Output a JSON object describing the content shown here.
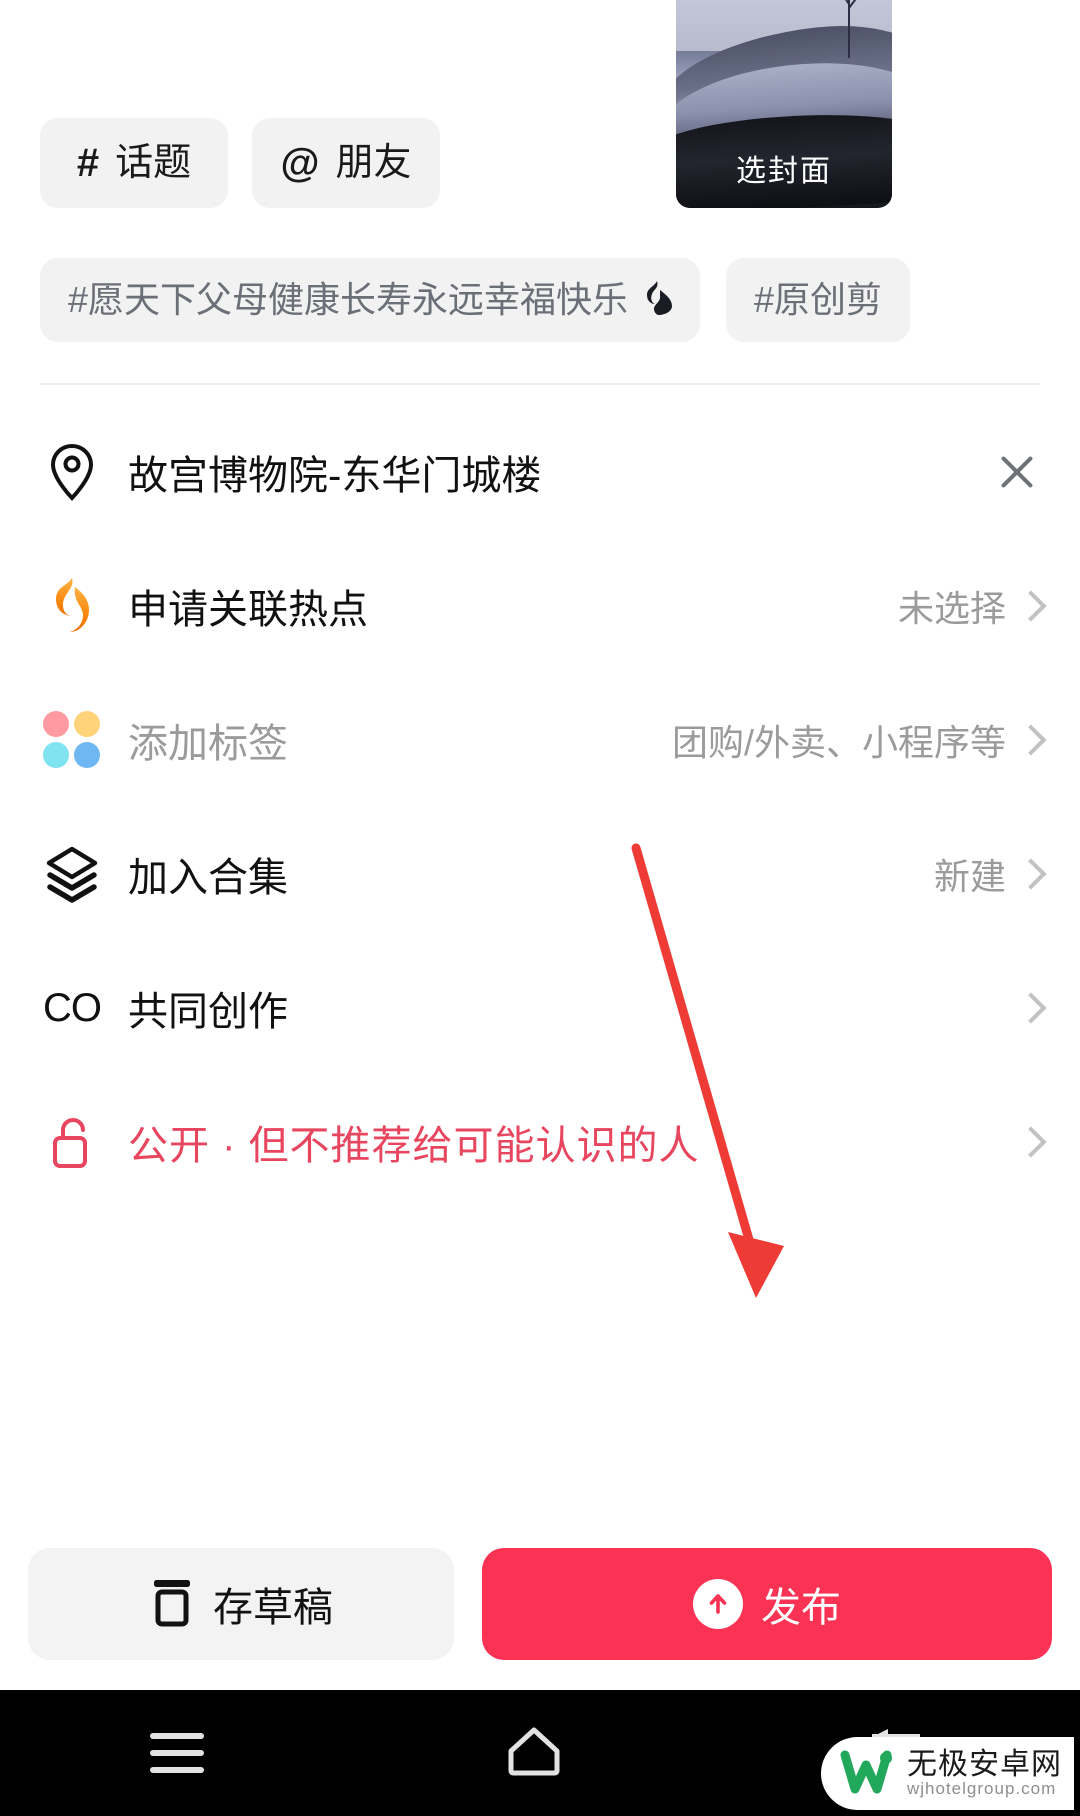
{
  "cover": {
    "label": "选封面",
    "image_desc": "snow-dunes-horse-rider"
  },
  "compose_chips": [
    {
      "symbol": "#",
      "label": "话题",
      "name": "topic-chip"
    },
    {
      "symbol": "@",
      "label": "朋友",
      "name": "friend-chip"
    }
  ],
  "hashtag_suggestions": [
    {
      "text": "#愿天下父母健康长寿永远幸福快乐",
      "hot": true,
      "hot_glyph": "🔥"
    },
    {
      "text": "#原创剪",
      "hot": false,
      "hot_glyph": ""
    }
  ],
  "options": [
    {
      "icon": "location-pin-icon",
      "label": "故宫博物院-东华门城楼",
      "value": "",
      "action": "close",
      "muted": false,
      "danger": false
    },
    {
      "icon": "flame-icon",
      "label": "申请关联热点",
      "value": "未选择",
      "action": "chevron",
      "muted": false,
      "danger": false
    },
    {
      "icon": "four-dots-icon",
      "label": "添加标签",
      "value": "团购/外卖、小程序等",
      "action": "chevron",
      "muted": true,
      "danger": false
    },
    {
      "icon": "layers-icon",
      "label": "加入合集",
      "value": "新建",
      "action": "chevron",
      "muted": false,
      "danger": false
    },
    {
      "icon": "co-icon",
      "label": "共同创作",
      "value": "",
      "action": "chevron",
      "muted": false,
      "danger": false
    },
    {
      "icon": "unlock-icon",
      "label": "公开 · 但不推荐给可能认识的人",
      "value": "",
      "action": "chevron",
      "muted": false,
      "danger": true
    }
  ],
  "actions": {
    "draft_label": "存草稿",
    "publish_label": "发布"
  },
  "navbar": {
    "recent_label": "recent-apps",
    "home_label": "home",
    "back_label": "back"
  },
  "watermark": {
    "cn": "无极安卓网",
    "en": "wjhotelgroup.com"
  },
  "colors": {
    "accent": "#fa3355",
    "danger_text": "#e8455f",
    "chip_bg": "#f2f2f2",
    "muted_text": "#9b9b9b",
    "annotation": "#ef3b36"
  }
}
